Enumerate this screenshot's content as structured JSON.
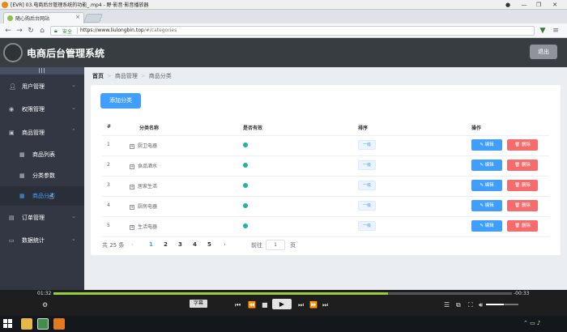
{
  "window": {
    "title": "[EVR] 03.电商后台管理系统的功能_.mp4 - 野·影音·影音播放器"
  },
  "browser": {
    "tab_title": "随心购后台网站",
    "secure_label": "安全",
    "url_host": "https://www.liulongbin.top",
    "url_path": "/#/categories"
  },
  "app": {
    "title": "电商后台管理系统",
    "logout_label": "退出",
    "toggle_label": "|||"
  },
  "sidebar": {
    "items": [
      {
        "label": "用户管理"
      },
      {
        "label": "权限管理"
      },
      {
        "label": "商品管理"
      },
      {
        "label": "商品列表"
      },
      {
        "label": "分类参数"
      },
      {
        "label": "商品分类"
      },
      {
        "label": "订单管理"
      },
      {
        "label": "数据统计"
      }
    ]
  },
  "breadcrumb": {
    "home": "首页",
    "level1": "商品管理",
    "level2": "商品分类",
    "separator": ">"
  },
  "main": {
    "add_button": "添加分类"
  },
  "table": {
    "headers": [
      "#",
      "分类名称",
      "是否有效",
      "排序",
      "操作"
    ],
    "rows": [
      {
        "index": "1",
        "name": "厨卫电器",
        "level": "一级"
      },
      {
        "index": "2",
        "name": "食品酒水",
        "level": "一级"
      },
      {
        "index": "3",
        "name": "居家生活",
        "level": "一级"
      },
      {
        "index": "4",
        "name": "厨房电器",
        "level": "一级"
      },
      {
        "index": "5",
        "name": "生活电器",
        "level": "一级"
      }
    ],
    "edit_label": "编辑",
    "delete_label": "删除"
  },
  "pagination": {
    "total": "共 25 条",
    "pages": [
      "1",
      "2",
      "3",
      "4",
      "5"
    ],
    "current": "1",
    "goto_prefix": "前往",
    "goto_value": "1",
    "goto_suffix": "页"
  },
  "player": {
    "elapsed": "01:32",
    "remaining": "-00:33",
    "progress": 0.73,
    "subtitle_label": "字幕"
  },
  "colors": {
    "primary": "#409eff",
    "danger": "#f56c6c",
    "sidebar": "#333744",
    "header": "#373d41"
  }
}
